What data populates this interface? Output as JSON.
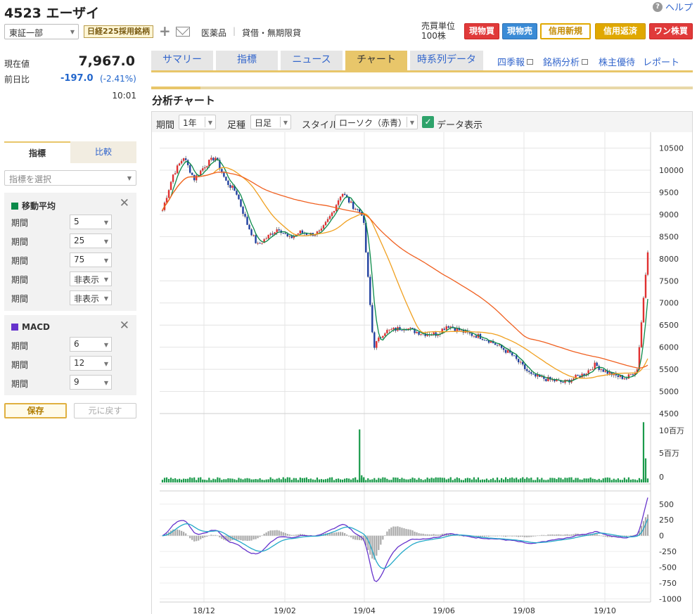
{
  "header": {
    "title": "4523 エーザイ",
    "help_label": "ヘルプ",
    "market": "東証一部",
    "badge": "日経225採用銘柄",
    "sector": "医薬品",
    "separator": "|",
    "margin_type": "貸借・無期限貸",
    "unit_label_1": "売買単位",
    "unit_label_2": "100株",
    "trade_buttons": [
      "現物買",
      "現物売",
      "信用新規",
      "信用返済",
      "ワン株買"
    ]
  },
  "price": {
    "label": "現在値",
    "value": "7,967.0",
    "change_label": "前日比",
    "change_value": "-197.0",
    "change_pct": "(-2.41%)",
    "time": "10:01"
  },
  "sidebar": {
    "tabs": [
      "指標",
      "比較"
    ],
    "indicator_placeholder": "指標を選択",
    "ma_panel": {
      "title": "移動平均",
      "color": "#0b8a4a",
      "row_label": "期間",
      "values": [
        "5",
        "25",
        "75",
        "非表示",
        "非表示"
      ]
    },
    "macd_panel": {
      "title": "MACD",
      "color": "#6633cc",
      "row_label": "期間",
      "values": [
        "6",
        "12",
        "9"
      ]
    },
    "save_label": "保存",
    "reset_label": "元に戻す"
  },
  "main_tabs": [
    "サマリー",
    "指標",
    "ニュース",
    "チャート",
    "時系列データ"
  ],
  "links": [
    "四季報",
    "銘柄分析",
    "株主優待",
    "レポート"
  ],
  "section_title": "分析チャート",
  "toolbar": {
    "period_label": "期間",
    "period_value": "1年",
    "interval_label": "足種",
    "interval_value": "日足",
    "style_label": "スタイル",
    "style_value": "ローソク（赤青）",
    "data_display_label": "データ表示"
  },
  "chart_data": [
    {
      "type": "candlestick",
      "x_ticks": [
        "18/12",
        "19/02",
        "19/04",
        "19/06",
        "19/08",
        "19/10"
      ],
      "y_ticks": [
        10500,
        10000,
        9500,
        9000,
        8500,
        8000,
        7500,
        7000,
        6500,
        6000,
        5500,
        5000,
        4500
      ],
      "ylim": [
        4500,
        10700
      ],
      "price_path": [
        9100,
        9900,
        10300,
        9800,
        10100,
        10300,
        9750,
        9500,
        8800,
        8300,
        8500,
        8700,
        8450,
        8600,
        8550,
        8600,
        9000,
        9500,
        9200,
        9000,
        6000,
        6350,
        6400,
        6450,
        6350,
        6300,
        6300,
        6500,
        6400,
        6300,
        6250,
        6150,
        6000,
        5850,
        5600,
        5350,
        5300,
        5250,
        5200,
        5300,
        5400,
        5600,
        5450,
        5350,
        5300,
        5500,
        8200
      ],
      "series": [
        {
          "name": "5",
          "color": "#0b8a4a"
        },
        {
          "name": "25",
          "color": "#f0a020"
        },
        {
          "name": "75",
          "color": "#f06020"
        }
      ]
    },
    {
      "type": "bar",
      "y_ticks": [
        "10百万",
        "5百万",
        "0"
      ],
      "spike_values_millions": [
        11,
        1.5,
        1.1,
        12.5,
        5
      ]
    },
    {
      "type": "line",
      "y_ticks": [
        500,
        250,
        0,
        -250,
        -500,
        -750,
        -1000
      ],
      "ylim": [
        -1050,
        620
      ],
      "series": [
        {
          "name": "MACD",
          "color": "#6633cc"
        },
        {
          "name": "Signal",
          "color": "#22a8c8"
        }
      ]
    }
  ]
}
